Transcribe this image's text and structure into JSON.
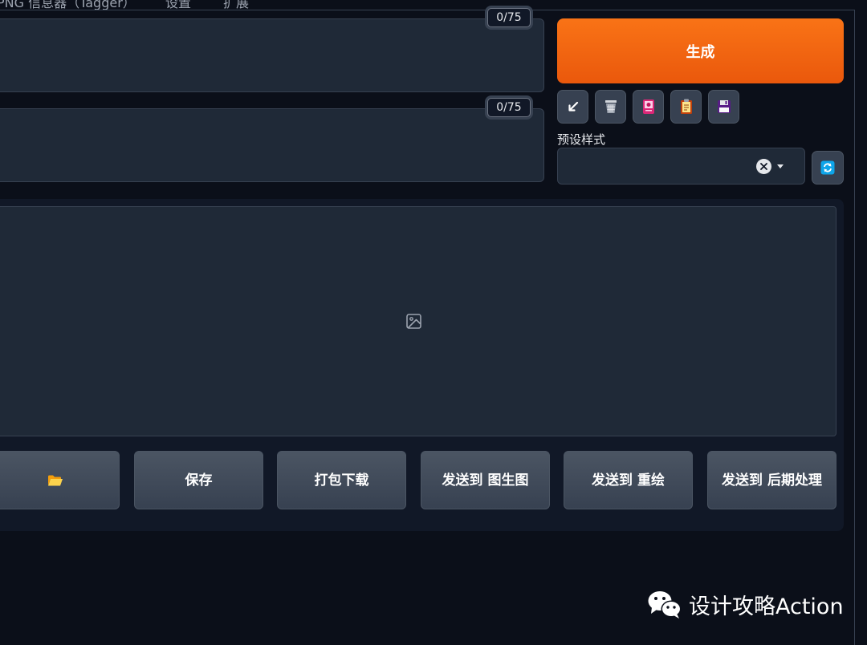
{
  "tabs": [
    {
      "label": "PNG 信息器（Tagger）"
    },
    {
      "label": "设置"
    },
    {
      "label": "扩展"
    }
  ],
  "prompt": {
    "positive_counter": "0/75",
    "negative_counter": "0/75"
  },
  "generate": {
    "label": "生成"
  },
  "tools": [
    {
      "icon": "arrow-down-left-icon"
    },
    {
      "icon": "trash-icon"
    },
    {
      "icon": "image-card-icon"
    },
    {
      "icon": "clipboard-icon"
    },
    {
      "icon": "floppy-disk-icon"
    }
  ],
  "styles": {
    "label": "预设样式"
  },
  "actions": [
    {
      "label": ""
    },
    {
      "label": "保存"
    },
    {
      "label": "打包下载"
    },
    {
      "label": "发送到 图生图"
    },
    {
      "label": "发送到 重绘"
    },
    {
      "label": "发送到 后期处理"
    }
  ],
  "watermark": {
    "text": "设计攻略Action"
  },
  "colors": {
    "accent": "#f97316",
    "background": "#0b0f19",
    "panel": "#1f2937"
  }
}
